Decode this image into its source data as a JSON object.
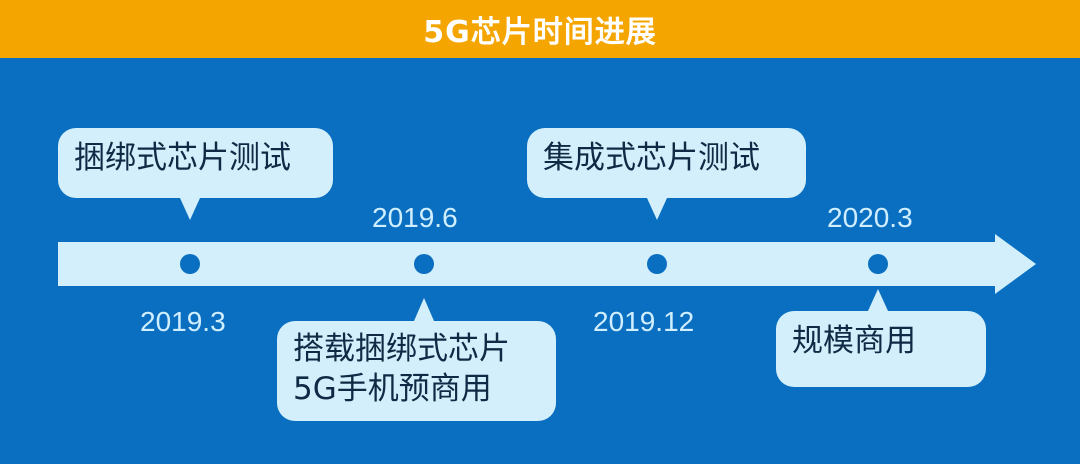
{
  "header": {
    "title": "5G芯片时间进展"
  },
  "timeline": {
    "events": [
      {
        "date": "2019.3",
        "label": "捆绑式芯片测试"
      },
      {
        "date": "2019.6",
        "label_lines": [
          "搭载捆绑式芯片",
          "5G手机预商用"
        ]
      },
      {
        "date": "2019.12",
        "label": "集成式芯片测试"
      },
      {
        "date": "2020.3",
        "label": "规模商用"
      }
    ]
  },
  "colors": {
    "header_bg": "#f5a500",
    "background": "#0a6fc0",
    "arrow": "#d3effb",
    "dot": "#0a6fc0",
    "callout_bg": "#d3effb"
  }
}
